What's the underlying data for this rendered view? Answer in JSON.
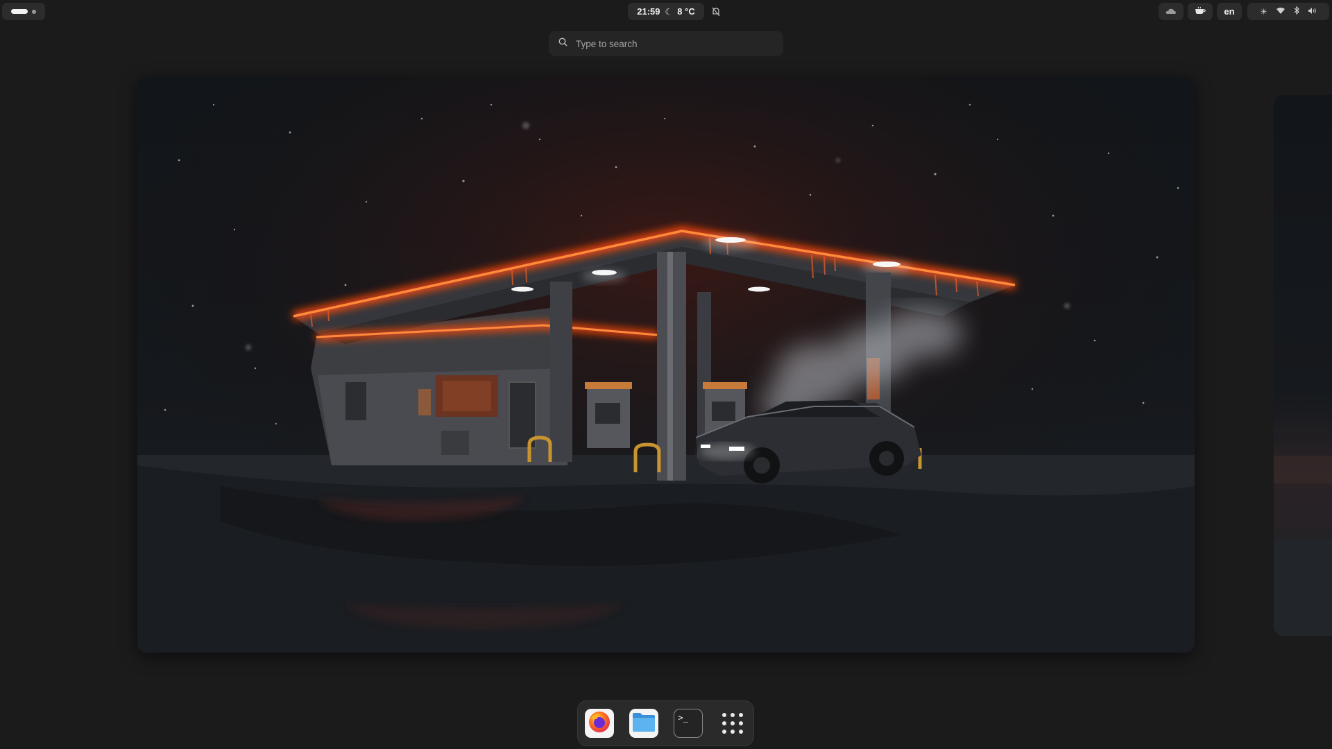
{
  "topbar": {
    "activities_icon": "workspace-indicator",
    "clock": {
      "time": "21:59",
      "weather_icon": "moon-icon",
      "temperature": "8 °C"
    },
    "notification_icon": "notifications-off-icon",
    "tray": {
      "cloud_icon": "cloud-icon",
      "cup_icon": "coffee-cup-icon"
    },
    "language": "en",
    "quick_settings": [
      "brightness-icon",
      "wifi-icon",
      "bluetooth-icon",
      "volume-icon"
    ]
  },
  "search": {
    "placeholder": "Type to search",
    "icon": "search-icon"
  },
  "workspaces": {
    "current": {
      "wallpaper": "neon gas station at night in snow"
    },
    "next": {
      "visible": true
    }
  },
  "dock": {
    "items": [
      {
        "name": "Firefox",
        "icon": "firefox-icon"
      },
      {
        "name": "Files",
        "icon": "files-folder-icon"
      },
      {
        "name": "Terminal",
        "icon": "terminal-icon",
        "glyph": ">_"
      },
      {
        "name": "Show Apps",
        "icon": "app-grid-icon"
      }
    ]
  },
  "colors": {
    "panel_bg": "#1b1b1b",
    "pill_bg": "#2c2c2c",
    "neon": "#ff5a1a"
  }
}
